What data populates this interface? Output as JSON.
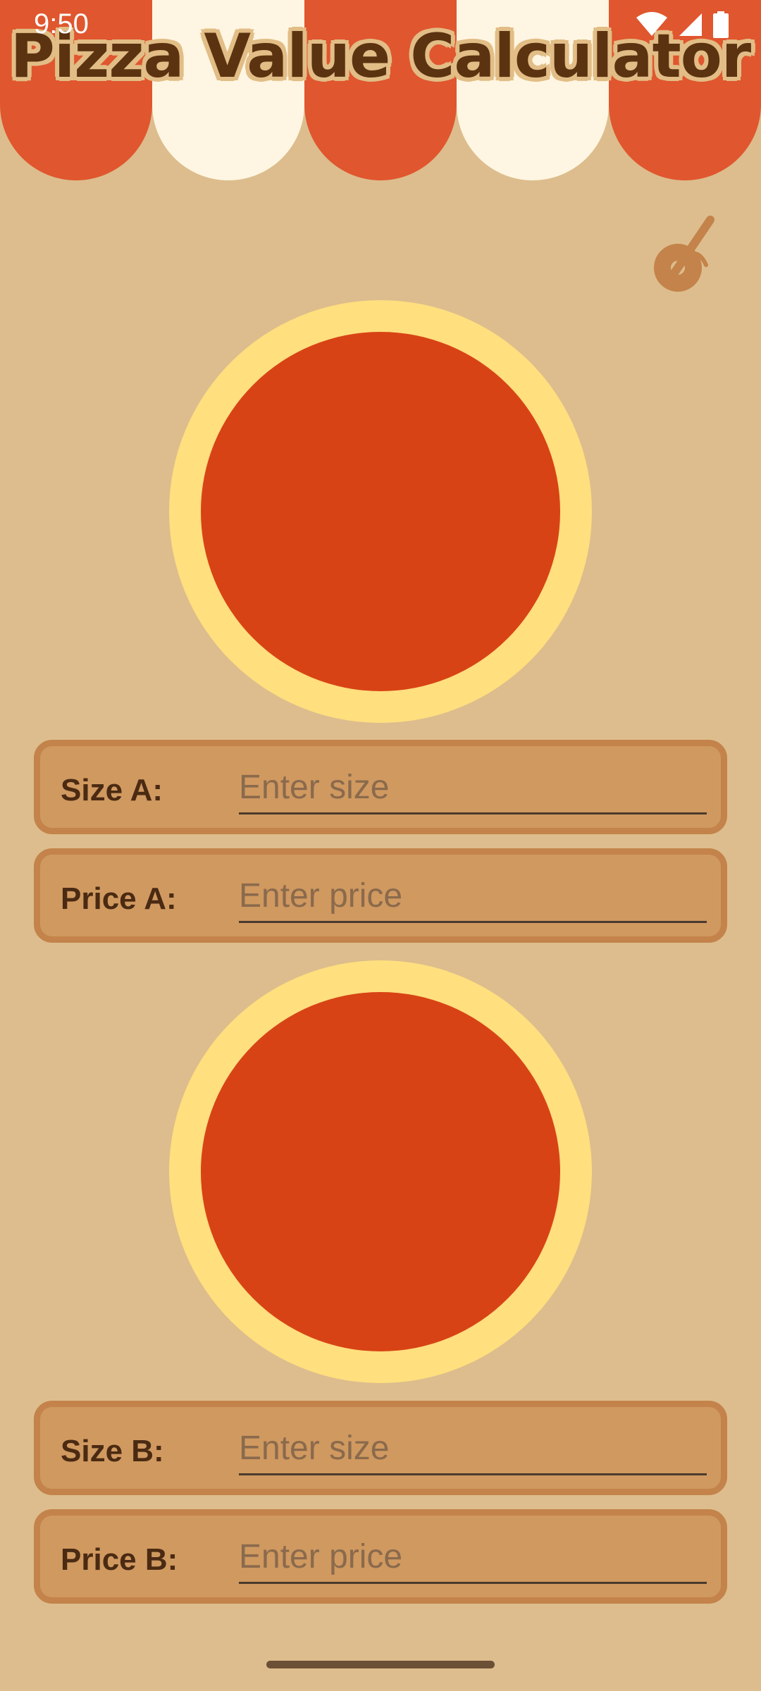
{
  "status_bar": {
    "time": "9:50",
    "icons": [
      "wifi-icon",
      "cell-signal-icon",
      "battery-icon"
    ]
  },
  "header": {
    "title": "Pizza Value Calculator"
  },
  "toolbar": {
    "icon": "pizza-cutter-icon"
  },
  "pizza_a": {
    "size_label": "Size A:",
    "size_placeholder": "Enter size",
    "price_label": "Price A:",
    "price_placeholder": "Enter price"
  },
  "pizza_b": {
    "size_label": "Size B:",
    "size_placeholder": "Enter size",
    "price_label": "Price B:",
    "price_placeholder": "Enter price"
  },
  "colors": {
    "background": "#ddbd8d",
    "awning_red": "#e0562e",
    "awning_cream": "#fef6e2",
    "crust": "#ffdf7e",
    "sauce": "#d84315",
    "card_fill": "#d09960",
    "card_border": "#c3834a",
    "title_text": "#5b3311"
  }
}
